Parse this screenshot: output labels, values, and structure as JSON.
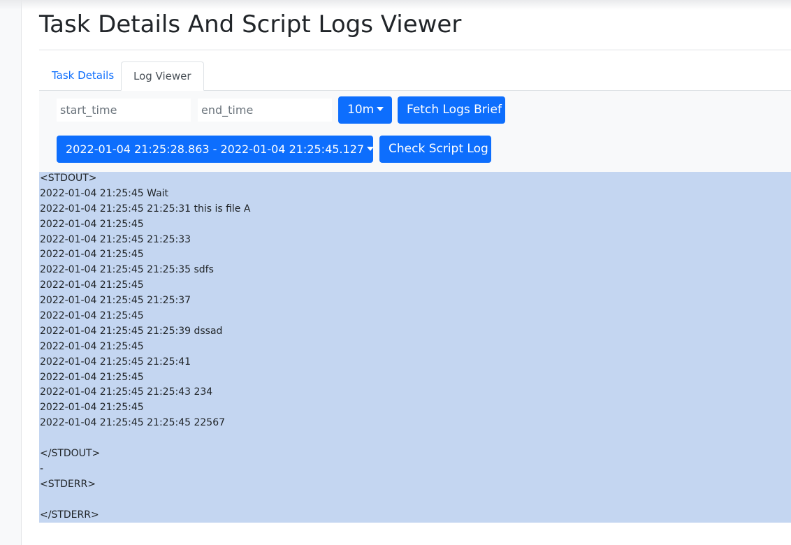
{
  "page": {
    "title": "Task Details And Script Logs Viewer"
  },
  "tabs": {
    "task_details": "Task Details",
    "log_viewer": "Log Viewer",
    "active": "Log Viewer"
  },
  "filters": {
    "start_placeholder": "start_time",
    "end_placeholder": "end_time",
    "start_value": "",
    "end_value": ""
  },
  "buttons": {
    "range_label": "10m",
    "fetch_label": "Fetch Logs Brief",
    "period_label": "2022-01-04 21:25:28.863 - 2022-01-04 21:25:45.127",
    "check_label": "Check Script Log"
  },
  "log": {
    "lines": [
      "<STDOUT>",
      "2022-01-04 21:25:45 Wait",
      "2022-01-04 21:25:45 21:25:31 this is file A",
      "2022-01-04 21:25:45",
      "2022-01-04 21:25:45 21:25:33",
      "2022-01-04 21:25:45",
      "2022-01-04 21:25:45 21:25:35 sdfs",
      "2022-01-04 21:25:45",
      "2022-01-04 21:25:45 21:25:37",
      "2022-01-04 21:25:45",
      "2022-01-04 21:25:45 21:25:39 dssad",
      "2022-01-04 21:25:45",
      "2022-01-04 21:25:45 21:25:41",
      "2022-01-04 21:25:45",
      "2022-01-04 21:25:45 21:25:43 234",
      "2022-01-04 21:25:45",
      "2022-01-04 21:25:45 21:25:45 22567",
      "",
      "</STDOUT>",
      "-",
      "<STDERR>",
      "",
      "</STDERR>"
    ]
  },
  "colors": {
    "primary": "#0d6efd",
    "log_background": "#c4d6f1",
    "panel_background": "#f8f9fa"
  }
}
